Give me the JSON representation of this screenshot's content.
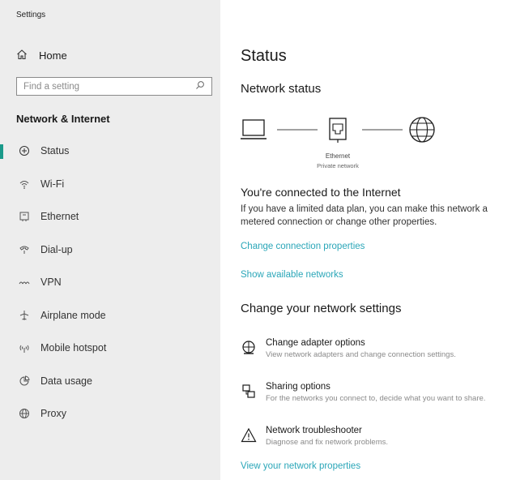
{
  "app": {
    "title": "Settings"
  },
  "sidebar": {
    "home_label": "Home",
    "search_placeholder": "Find a setting",
    "section_title": "Network & Internet",
    "items": [
      {
        "label": "Status",
        "icon": "status-icon",
        "active": true
      },
      {
        "label": "Wi-Fi",
        "icon": "wifi-icon"
      },
      {
        "label": "Ethernet",
        "icon": "ethernet-icon"
      },
      {
        "label": "Dial-up",
        "icon": "dialup-icon"
      },
      {
        "label": "VPN",
        "icon": "vpn-icon"
      },
      {
        "label": "Airplane mode",
        "icon": "airplane-icon"
      },
      {
        "label": "Mobile hotspot",
        "icon": "hotspot-icon"
      },
      {
        "label": "Data usage",
        "icon": "data-usage-icon"
      },
      {
        "label": "Proxy",
        "icon": "proxy-icon"
      }
    ]
  },
  "main": {
    "title": "Status",
    "network_status_heading": "Network status",
    "diagram": {
      "adapter_name": "Ethernet",
      "network_type": "Private network"
    },
    "connected_title": "You're connected to the Internet",
    "connected_desc": "If you have a limited data plan, you can make this network a metered connection or change other properties.",
    "link_change_properties": "Change connection properties",
    "link_show_networks": "Show available networks",
    "change_heading": "Change your network settings",
    "options": [
      {
        "title": "Change adapter options",
        "desc": "View network adapters and change connection settings.",
        "icon": "adapter-icon"
      },
      {
        "title": "Sharing options",
        "desc": "For the networks you connect to, decide what you want to share.",
        "icon": "sharing-icon"
      },
      {
        "title": "Network troubleshooter",
        "desc": "Diagnose and fix network problems.",
        "icon": "warning-icon"
      }
    ],
    "link_view_properties": "View your network properties"
  },
  "colors": {
    "accent": "#1a9a8a",
    "link": "#2aa6b8",
    "sidebar_bg": "#ededed"
  }
}
